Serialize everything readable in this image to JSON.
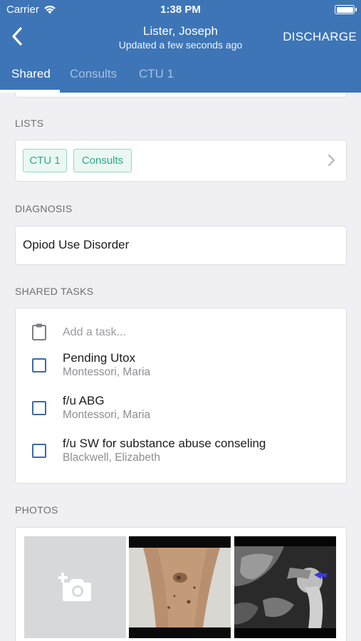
{
  "status_bar": {
    "carrier": "Carrier",
    "time": "1:38 PM"
  },
  "nav": {
    "title": "Lister, Joseph",
    "subtitle": "Updated a few seconds ago",
    "discharge_label": "DISCHARGE"
  },
  "tabs": [
    {
      "label": "Shared",
      "active": true
    },
    {
      "label": "Consults",
      "active": false
    },
    {
      "label": "CTU 1",
      "active": false
    }
  ],
  "lists": {
    "label": "LISTS",
    "chips": [
      "CTU 1",
      "Consults"
    ]
  },
  "diagnosis": {
    "label": "DIAGNOSIS",
    "value": "Opiod Use Disorder"
  },
  "shared_tasks": {
    "label": "SHARED TASKS",
    "add_placeholder": "Add a task...",
    "items": [
      {
        "title": "Pending Utox",
        "assignee": "Montessori, Maria",
        "done": false
      },
      {
        "title": "f/u ABG",
        "assignee": "Montessori, Maria",
        "done": false
      },
      {
        "title": "f/u SW for substance abuse conseling",
        "assignee": "Blackwell, Elizabeth",
        "done": false
      }
    ]
  },
  "photos": {
    "label": "PHOTOS",
    "items": [
      "add-photo",
      "leg-wound-photo",
      "hip-xray-photo"
    ]
  },
  "colors": {
    "header": "#3d75b7",
    "chip_text": "#2fa88a",
    "chip_border": "#8fd9c4",
    "checkbox": "#3d6aa6",
    "background": "#efeff4"
  }
}
